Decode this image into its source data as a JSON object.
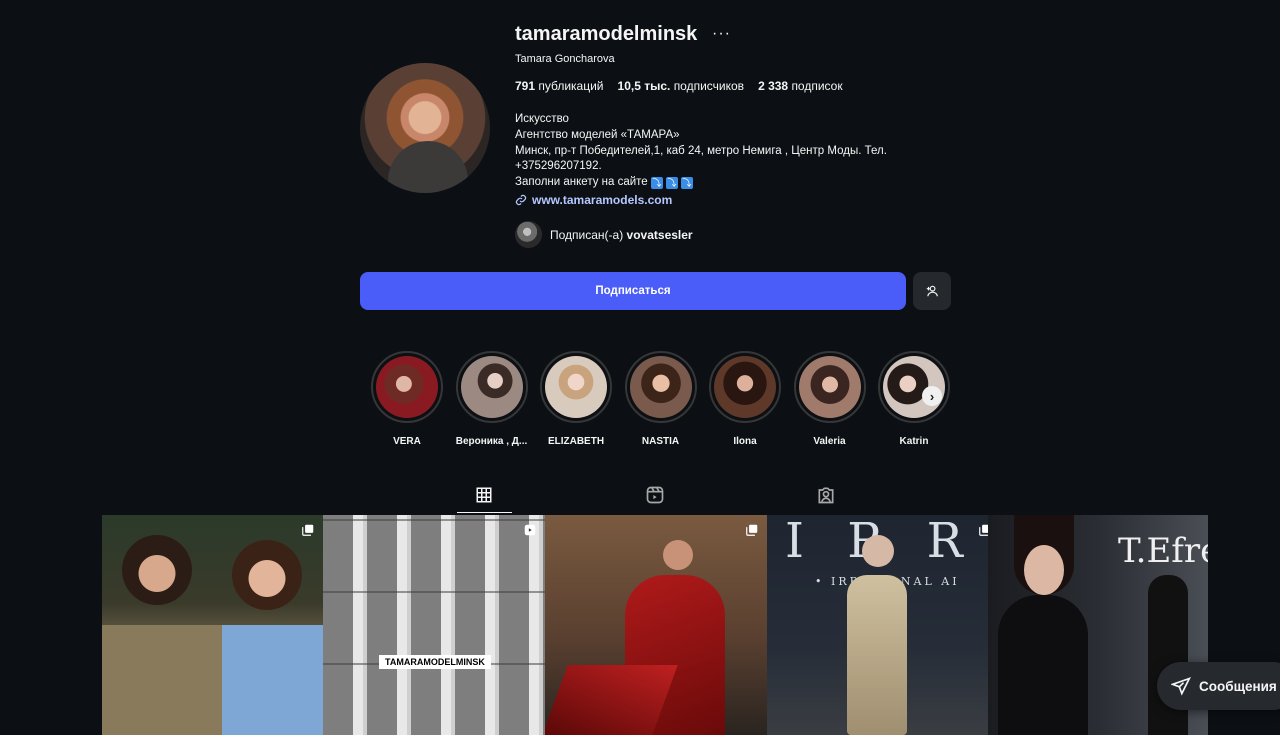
{
  "profile": {
    "username": "tamaramodelminsk",
    "more_icon": "···",
    "full_name": "Tamara Goncharova",
    "stats": {
      "posts_count": "791",
      "posts_label": "публикаций",
      "followers_count": "10,5 тыс.",
      "followers_label": "подписчиков",
      "following_count": "2 338",
      "following_label": "подписок"
    },
    "bio": {
      "category": "Искусство",
      "line1": "Агентство моделей «ТАМАРА»",
      "line2": "Минск, пр-т Победителей,1, каб 24, метро Немига , Центр Моды. Тел.",
      "line3": "+375296207192.",
      "line4": "Заполни анкету на сайте"
    },
    "website": "www.tamaramodels.com",
    "followed_by_prefix": "Подписан(-а)",
    "followed_by_user": "vovatsesler"
  },
  "actions": {
    "follow_label": "Подписаться",
    "suggest_icon": "person-add-icon"
  },
  "highlights": [
    {
      "label": "VERA",
      "color": "#8a1a22"
    },
    {
      "label": "Вероника , Д...",
      "color": "#9c8a82"
    },
    {
      "label": "ELIZABETH",
      "color": "#c9b7a6"
    },
    {
      "label": "NASTIA",
      "color": "#7a5a4c"
    },
    {
      "label": "Ilona",
      "color": "#5e3828"
    },
    {
      "label": "Valeria",
      "color": "#a07a6a"
    },
    {
      "label": "Katrin",
      "color": "#d2c6bf"
    }
  ],
  "tabs": [
    {
      "name": "posts",
      "icon": "grid-icon",
      "active": true
    },
    {
      "name": "reels",
      "icon": "reels-icon",
      "active": false
    },
    {
      "name": "tagged",
      "icon": "tagged-icon",
      "active": false
    }
  ],
  "posts": {
    "caption_post2": "TAMARAMODELMINSK",
    "post4_text_big": "I R R",
    "post4_text_small": "• IRRATIONAL AI",
    "post5_text": "T.Efre"
  },
  "messages_label": "Сообщения"
}
